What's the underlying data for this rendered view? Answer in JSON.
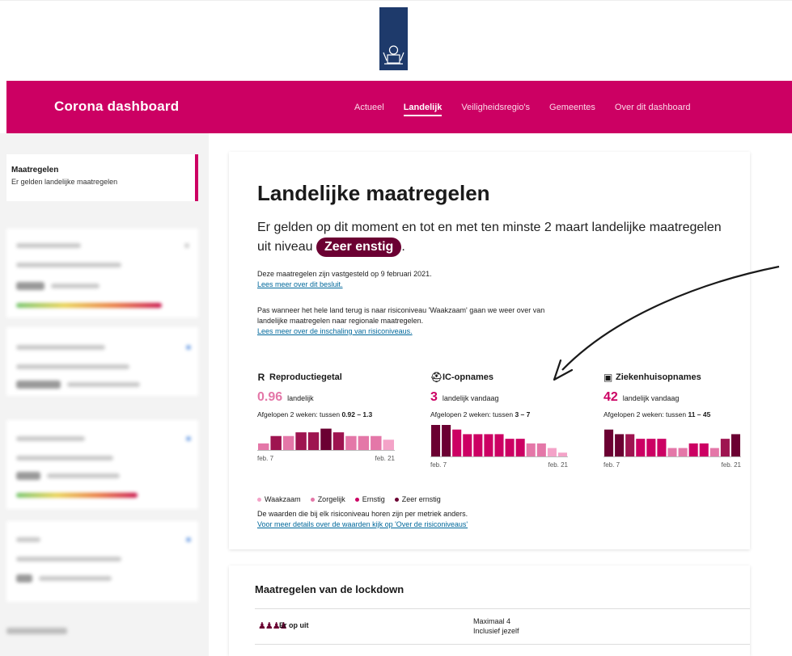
{
  "header": {
    "brand": "Corona dashboard",
    "logo_color": "#1e3a6b",
    "brand_color": "#cc0063"
  },
  "nav": {
    "items": [
      "Actueel",
      "Landelijk",
      "Veiligheidsregio's",
      "Gemeentes",
      "Over dit dashboard"
    ],
    "active": "Landelijk"
  },
  "sidebar": {
    "active_title": "Maatregelen",
    "active_subtitle": "Er gelden landelijke maatregelen"
  },
  "main": {
    "title": "Landelijke maatregelen",
    "lead_before": "Er gelden op dit moment en tot en met ten minste 2 maart landelijke maatregelen uit niveau",
    "level_badge": "Zeer enstig",
    "lead_after": ".",
    "p1": "Deze maatregelen zijn vastgesteld op 9 februari 2021.",
    "p1_link": "Lees meer over dit besluit.",
    "p2": "Pas wanneer het hele land terug is naar risiconiveau 'Waakzaam' gaan we weer over van landelijke maatregelen naar regionale maatregelen.",
    "p2_link": "Lees meer over de inschaling van risiconiveaus.",
    "metrics": [
      {
        "icon": "R",
        "icon_name": "r-icon",
        "title": "Reproductiegetal",
        "value": "0.96",
        "value_color": "#e477a8",
        "unit": "landelijk",
        "range_prefix": "Afgelopen 2 weken: tussen ",
        "range": "0.92 – 1.3",
        "x_start": "feb. 7",
        "x_end": "feb. 21"
      },
      {
        "icon": "⛑",
        "icon_name": "ic-bed-icon",
        "title": "IC-opnames",
        "value": "3",
        "value_color": "#cc0063",
        "unit": "landelijk vandaag",
        "range_prefix": "Afgelopen 2 weken: tussen ",
        "range": "3 – 7",
        "x_start": "feb. 7",
        "x_end": "feb. 21"
      },
      {
        "icon": "▣",
        "icon_name": "hospital-icon",
        "title": "Ziekenhuisopnames",
        "value": "42",
        "value_color": "#cc0063",
        "unit": "landelijk vandaag",
        "range_prefix": "Afgelopen 2 weken: tussen ",
        "range": "11 – 45",
        "x_start": "feb. 7",
        "x_end": "feb. 21"
      }
    ],
    "legend": [
      {
        "label": "Waakzaam",
        "color": "#f4a3c8"
      },
      {
        "label": "Zorgelijk",
        "color": "#e477a8"
      },
      {
        "label": "Ernstig",
        "color": "#cc0063"
      },
      {
        "label": "Zeer ernstig",
        "color": "#6b0032"
      }
    ],
    "note": "De waarden die bij elk risiconiveau horen zijn per metriek anders.",
    "note_link": "Voor meer details over de waarden kijk op 'Over de risiconiveaus'"
  },
  "lockdown": {
    "title": "Maatregelen van de lockdown",
    "row_label": "Er op uit",
    "row_value_1": "Maximaal 4",
    "row_value_2": "Inclusief jezelf"
  },
  "chart_data": [
    {
      "type": "bar",
      "series": [
        {
          "values": [
            2,
            4,
            4,
            5,
            5,
            6,
            5,
            4,
            4,
            4,
            3
          ]
        }
      ],
      "colors": [
        "#e477a8",
        "#9e1450",
        "#e477a8",
        "#9e1450",
        "#9e1450",
        "#6b0032",
        "#9e1450",
        "#e477a8",
        "#e477a8",
        "#e477a8",
        "#f4a3c8"
      ],
      "ylim": [
        0,
        7
      ]
    },
    {
      "type": "bar",
      "series": [
        {
          "values": [
            7,
            7,
            6,
            5,
            5,
            5,
            5,
            4,
            4,
            3,
            3,
            2,
            1
          ]
        }
      ],
      "colors": [
        "#6b0032",
        "#6b0032",
        "#cc0063",
        "#cc0063",
        "#cc0063",
        "#cc0063",
        "#cc0063",
        "#cc0063",
        "#cc0063",
        "#e477a8",
        "#e477a8",
        "#f4a3c8",
        "#f4a3c8"
      ],
      "ylim": [
        0,
        7
      ]
    },
    {
      "type": "bar",
      "series": [
        {
          "values": [
            6,
            5,
            5,
            4,
            4,
            4,
            2,
            2,
            3,
            3,
            2,
            4,
            5
          ]
        }
      ],
      "colors": [
        "#6b0032",
        "#6b0032",
        "#9e1450",
        "#cc0063",
        "#cc0063",
        "#cc0063",
        "#e477a8",
        "#e477a8",
        "#cc0063",
        "#cc0063",
        "#e477a8",
        "#9e1450",
        "#6b0032"
      ],
      "ylim": [
        0,
        7
      ]
    }
  ]
}
